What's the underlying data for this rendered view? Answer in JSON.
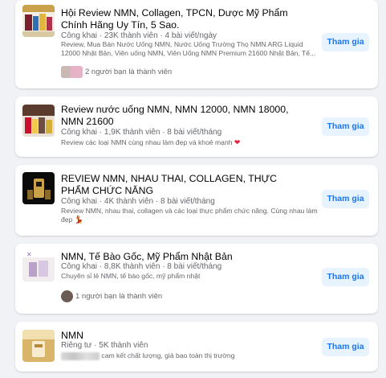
{
  "join_label": "Tham gia",
  "groups": [
    {
      "title": "Hội Review NMN, Collagen, TPCN, Dược Mỹ Phẩm Chính Hãng Uy Tín, 5 Sao.",
      "meta": "Công khai · 23K thành viên · 4 bài viết/ngày",
      "description": "Review, Mua Bán Nước Uống NMN, Nước Uống Trường Thọ NMN ARG Liquid 12000 Nhật Bản, Viên uống NMN, Viên Uống NMN Premium 21600 Nhật Bản, Tế...",
      "friends": "2 người bạn là thành viên"
    },
    {
      "title": "Review nước uống NMN, NMN 12000, NMN 18000, NMN 21600",
      "meta": "Công khai · 1,9K thành viên · 8 bài viết/tháng",
      "description": "Review các loại NMN cùng nhau làm đẹp và khoẻ mạnh",
      "emoji": "❤"
    },
    {
      "title": "REVIEW NMN, NHAU THAI, COLLAGEN, THỰC PHẨM CHỨC NĂNG",
      "meta": "Công khai · 4K thành viên · 8 bài viết/tháng",
      "description": "Review NMN, nhau thai, collagen và các loại thực phẩm chức năng. Cùng nhau làm đẹp",
      "emoji": "💃"
    },
    {
      "title": "NMN, Tế Bào Gốc, Mỹ Phẩm Nhật Bản",
      "meta": "Công khai · 8,8K thành viên · 8 bài viết/tháng",
      "description": "Chuyên sỉ lẻ NMN, tế bào gốc, mỹ phẩm nhật",
      "friends": "1 người bạn là thành viên"
    },
    {
      "title": "NMN",
      "meta": "Riêng tư · 5K thành viên",
      "description": "cam kết chất lượng, giá bao toàn thị trường"
    }
  ]
}
